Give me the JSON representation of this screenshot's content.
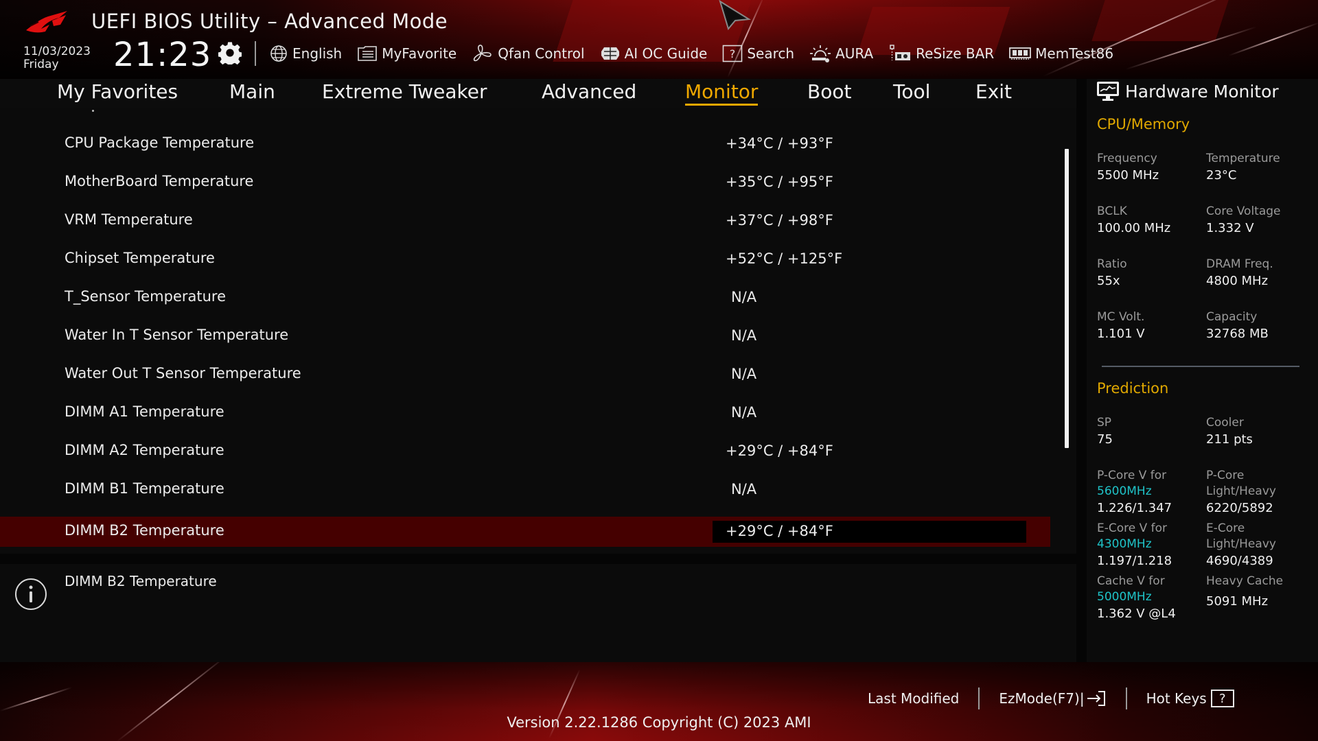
{
  "header": {
    "title": "UEFI BIOS Utility – Advanced Mode",
    "date": "11/03/2023",
    "day": "Friday",
    "time": "21:23",
    "toolbar": [
      {
        "label": "English",
        "icon": "globe-icon"
      },
      {
        "label": "MyFavorite",
        "icon": "list-icon"
      },
      {
        "label": "Qfan Control",
        "icon": "fan-icon"
      },
      {
        "label": "AI OC Guide",
        "icon": "brain-icon"
      },
      {
        "label": "Search",
        "icon": "question-box-icon"
      },
      {
        "label": "AURA",
        "icon": "aura-light-icon"
      },
      {
        "label": "ReSize BAR",
        "icon": "pcie-card-icon"
      },
      {
        "label": "MemTest86",
        "icon": "memory-module-icon"
      }
    ]
  },
  "nav": {
    "active": "Monitor",
    "tabs": [
      {
        "label": "My Favorites"
      },
      {
        "label": "Main"
      },
      {
        "label": "Extreme Tweaker"
      },
      {
        "label": "Advanced"
      },
      {
        "label": "Monitor"
      },
      {
        "label": "Boot"
      },
      {
        "label": "Tool"
      },
      {
        "label": "Exit"
      }
    ]
  },
  "monitor": {
    "rows": [
      {
        "label": "CPU Package Temperature",
        "value": "+34°C / +93°F"
      },
      {
        "label": "MotherBoard Temperature",
        "value": "+35°C / +95°F"
      },
      {
        "label": "VRM Temperature",
        "value": "+37°C / +98°F"
      },
      {
        "label": "Chipset Temperature",
        "value": "+52°C / +125°F"
      },
      {
        "label": "T_Sensor Temperature",
        "value": "N/A"
      },
      {
        "label": "Water In T Sensor Temperature",
        "value": "N/A"
      },
      {
        "label": "Water Out T Sensor Temperature",
        "value": "N/A"
      },
      {
        "label": "DIMM A1 Temperature",
        "value": "N/A"
      },
      {
        "label": "DIMM A2 Temperature",
        "value": "+29°C / +84°F"
      },
      {
        "label": "DIMM B1 Temperature",
        "value": "N/A"
      },
      {
        "label": "DIMM B2 Temperature",
        "value": "+29°C / +84°F",
        "selected": true
      }
    ]
  },
  "info": {
    "text": "DIMM B2 Temperature"
  },
  "hardware_monitor": {
    "title": "Hardware Monitor",
    "cpu_memory": {
      "title": "CPU/Memory",
      "items": [
        {
          "key": "Frequency",
          "value": "5500 MHz"
        },
        {
          "key": "Temperature",
          "value": "23°C"
        },
        {
          "key": "BCLK",
          "value": "100.00 MHz"
        },
        {
          "key": "Core Voltage",
          "value": "1.332 V"
        },
        {
          "key": "Ratio",
          "value": "55x"
        },
        {
          "key": "DRAM Freq.",
          "value": "4800 MHz"
        },
        {
          "key": "MC Volt.",
          "value": "1.101 V"
        },
        {
          "key": "Capacity",
          "value": "32768 MB"
        }
      ]
    },
    "prediction": {
      "title": "Prediction",
      "sp": {
        "key": "SP",
        "value": "75"
      },
      "cooler": {
        "key": "Cooler",
        "value": "211 pts"
      },
      "pcore_v": {
        "key": "P-Core V for",
        "freq": "5600MHz",
        "value": "1.226/1.347"
      },
      "pcore_lh": {
        "key1": "P-Core",
        "key2": "Light/Heavy",
        "value": "6220/5892"
      },
      "ecore_v": {
        "key": "E-Core V for",
        "freq": "4300MHz",
        "value": "1.197/1.218"
      },
      "ecore_lh": {
        "key1": "E-Core",
        "key2": "Light/Heavy",
        "value": "4690/4389"
      },
      "cache_v": {
        "key": "Cache V for",
        "freq": "5000MHz",
        "value": "1.362 V @L4"
      },
      "heavy_cache": {
        "key": "Heavy Cache",
        "value": "5091 MHz"
      }
    }
  },
  "footer": {
    "last_modified": "Last Modified",
    "ezmode": "EzMode(F7)|",
    "hotkeys": "Hot Keys",
    "hotkeys_key": "?",
    "version": "Version 2.22.1286 Copyright (C) 2023 AMI"
  },
  "colors": {
    "accent": "#f0a800",
    "selected_row": "#450000",
    "frequency_highlight": "#1fc3c8"
  }
}
